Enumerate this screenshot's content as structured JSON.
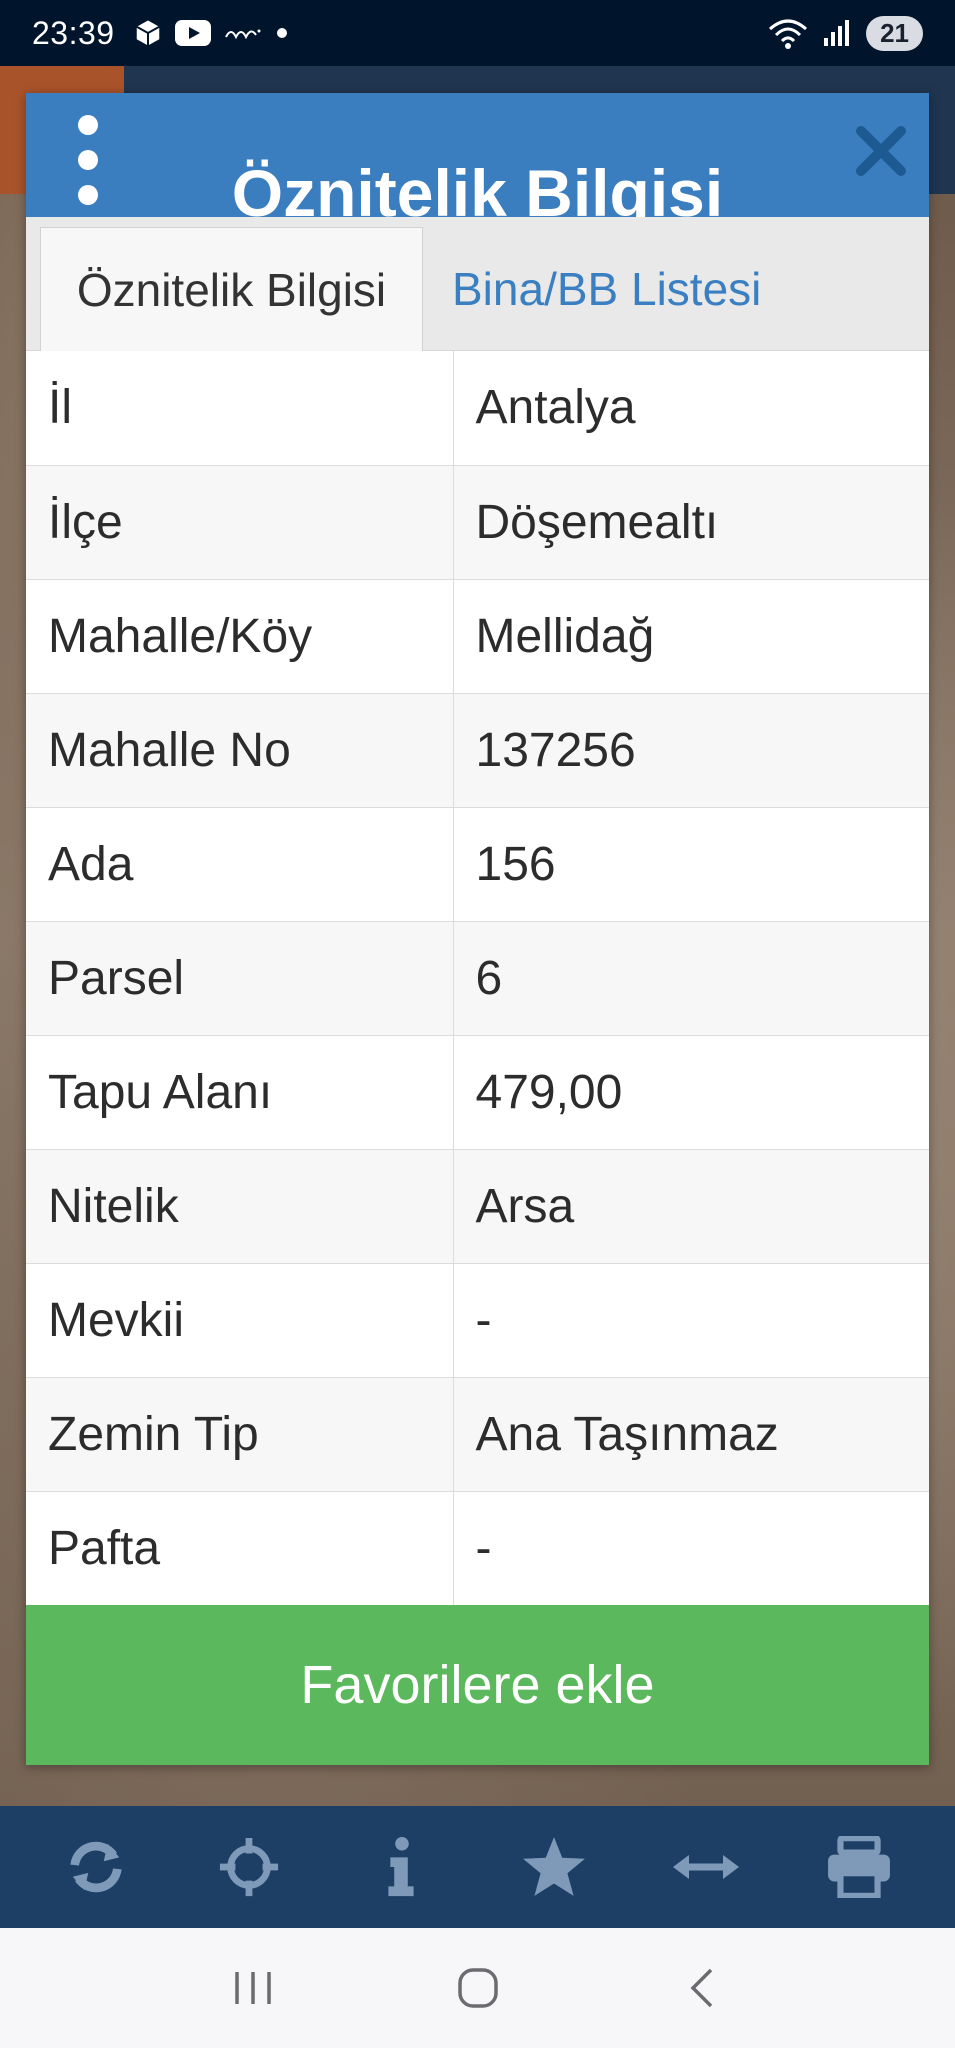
{
  "status_bar": {
    "time": "23:39",
    "battery": "21"
  },
  "dialog": {
    "title": "Öznitelik Bilgisi",
    "tabs": [
      {
        "label": "Öznitelik Bilgisi",
        "active": true
      },
      {
        "label": "Bina/BB Listesi",
        "active": false
      }
    ],
    "rows": [
      {
        "label": "İl",
        "value": "Antalya"
      },
      {
        "label": "İlçe",
        "value": "Döşemealtı"
      },
      {
        "label": "Mahalle/Köy",
        "value": "Mellidağ"
      },
      {
        "label": "Mahalle No",
        "value": "137256"
      },
      {
        "label": "Ada",
        "value": "156"
      },
      {
        "label": "Parsel",
        "value": "6"
      },
      {
        "label": "Tapu Alanı",
        "value": "479,00"
      },
      {
        "label": "Nitelik",
        "value": "Arsa"
      },
      {
        "label": "Mevkii",
        "value": "-"
      },
      {
        "label": "Zemin Tip",
        "value": "Ana Taşınmaz"
      },
      {
        "label": "Pafta",
        "value": "-"
      }
    ],
    "favorite_label": "Favorilere ekle"
  },
  "toolbar": {
    "icons": [
      "refresh-icon",
      "crosshair-icon",
      "info-icon",
      "star-icon",
      "measure-icon",
      "print-icon"
    ]
  },
  "navbar": {
    "icons": [
      "recent-apps-icon",
      "home-icon",
      "back-icon"
    ]
  },
  "colors": {
    "header": "#3b7ec0",
    "favorite_button": "#5cb85c",
    "toolbar": "#1d3f66",
    "status_bar": "#00152b"
  }
}
